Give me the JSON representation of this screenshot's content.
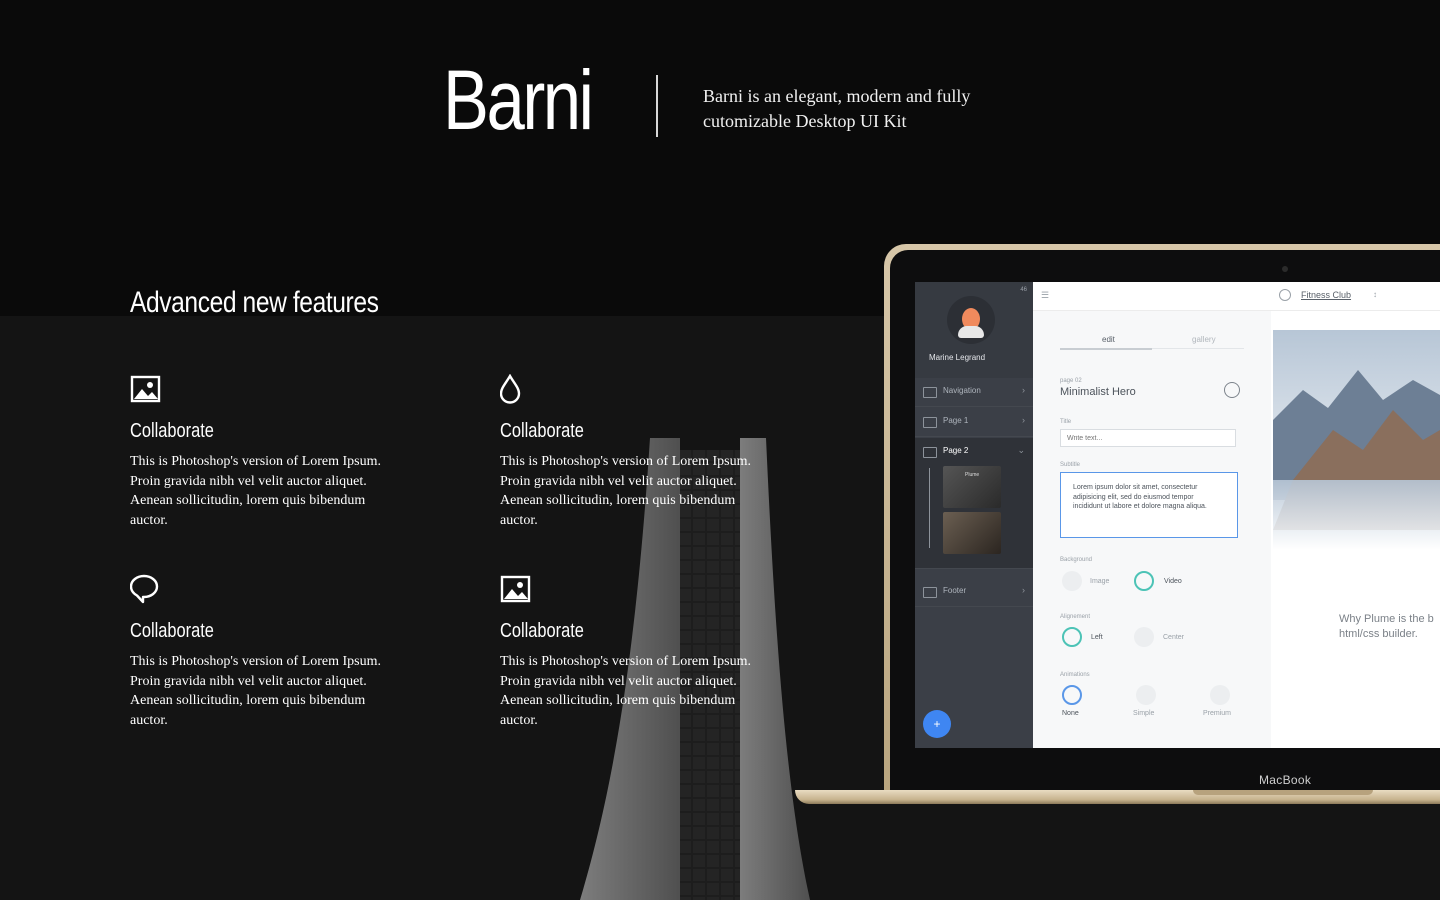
{
  "header": {
    "brand": "Barni",
    "tagline": "Barni is an elegant, modern and fully cutomizable Desktop UI Kit"
  },
  "section": {
    "title": "Advanced new features"
  },
  "features": [
    {
      "icon": "image-icon",
      "title": "Collaborate",
      "description": "This is Photoshop's version  of Lorem Ipsum.\nProin gravida nibh vel velit auctor aliquet.\nAenean sollicitudin, lorem quis bibendum\nauctor."
    },
    {
      "icon": "drop-icon",
      "title": "Collaborate",
      "description": "This is Photoshop's version  of Lorem Ipsum.\nProin gravida nibh vel velit auctor aliquet.\nAenean sollicitudin, lorem quis bibendum\nauctor."
    },
    {
      "icon": "chat-bubble-icon",
      "title": "Collaborate",
      "description": "This is Photoshop's version  of Lorem Ipsum.\nProin gravida nibh vel velit auctor aliquet.\nAenean sollicitudin, lorem quis bibendum\nauctor."
    },
    {
      "icon": "image-icon",
      "title": "Collaborate",
      "description": "This is Photoshop's version  of Lorem Ipsum.\nProin gravida nibh vel velit auctor aliquet.\nAenean sollicitudin, lorem quis bibendum\nauctor."
    }
  ],
  "laptop": {
    "label": "MacBook",
    "screen": {
      "status": "46",
      "username": "Marine Legrand",
      "nav_items": [
        "Navigation",
        "Page 1",
        "Page 2",
        "Footer"
      ],
      "thumb_label": "Plume",
      "site_title": "Fitness Club",
      "tabs": [
        "edit",
        "gallery"
      ],
      "page_kicker": "page 02",
      "section_name": "Minimalist Hero",
      "title_label": "Title",
      "title_placeholder": "Write text...",
      "subtitle_label": "Subtitle",
      "subtitle_value": "Lorem ipsum dolor sit amet, consectetur adipisicing elit, sed do eiusmod tempor incididunt ut labore et dolore magna aliqua.",
      "background_label": "Background",
      "background_options": [
        "Image",
        "Video"
      ],
      "alignment_label": "Alignement",
      "alignment_options": [
        "Left",
        "Center"
      ],
      "animations_label": "Animations",
      "animation_options": [
        "None",
        "Simple",
        "Premium"
      ],
      "preview_headline": "Why Plume is the b html/css builder."
    }
  },
  "colors": {
    "background": "#0b0b0b",
    "text": "#ffffff",
    "laptop_gold": "#c9b48e",
    "nav_panel": "#3b3f47",
    "accent_blue": "#3f86f2",
    "accent_teal": "#4cc3b6"
  }
}
